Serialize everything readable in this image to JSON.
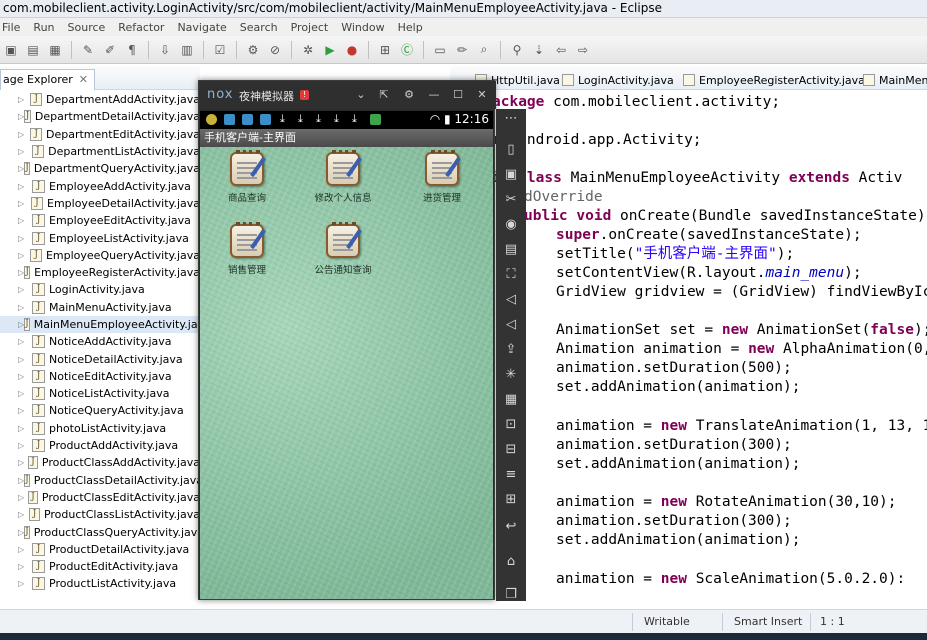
{
  "window": {
    "title": "com.mobileclient.activity.LoginActivity/src/com/mobileclient/activity/MainMenuEmployeeActivity.java - Eclipse"
  },
  "menu": [
    "File",
    "Run",
    "Source",
    "Refactor",
    "Navigate",
    "Search",
    "Project",
    "Window",
    "Help"
  ],
  "package_explorer": {
    "tab_label": "age Explorer",
    "close_glyph": "✕",
    "files": [
      "DepartmentAddActivity.java",
      "DepartmentDetailActivity.java",
      "DepartmentEditActivity.java",
      "DepartmentListActivity.java",
      "DepartmentQueryActivity.java",
      "EmployeeAddActivity.java",
      "EmployeeDetailActivity.java",
      "EmployeeEditActivity.java",
      "EmployeeListActivity.java",
      "EmployeeQueryActivity.java",
      "EmployeeRegisterActivity.java",
      "LoginActivity.java",
      "MainMenuActivity.java",
      "MainMenuEmployeeActivity.java",
      "NoticeAddActivity.java",
      "NoticeDetailActivity.java",
      "NoticeEditActivity.java",
      "NoticeListActivity.java",
      "NoticeQueryActivity.java",
      "photoListActivity.java",
      "ProductAddActivity.java",
      "ProductClassAddActivity.java",
      "ProductClassDetailActivity.java",
      "ProductClassEditActivity.java",
      "ProductClassListActivity.java",
      "ProductClassQueryActivity.java",
      "ProductDetailActivity.java",
      "ProductEditActivity.java",
      "ProductListActivity.java"
    ],
    "selected_index": 13
  },
  "editor": {
    "tabs": [
      "HttpUtil.java",
      "LoginActivity.java",
      "EmployeeRegisterActivity.java",
      "MainMenu"
    ],
    "code": {
      "l1_kw": "ackage",
      "l1_rest": " com.mobileclient.activity;",
      "l2_kw": "rt",
      "l2_rest": " android.app.Activity;",
      "l3_kw1": "ic",
      "l3_kw2": "class",
      "l3_mid": " MainMenuEmployeeActivity ",
      "l3_kw3": "extends",
      "l3_rest": " Activ",
      "l4": "dOverride",
      "l5_kw1": "ublic",
      "l5_kw2": "void",
      "l5_rest": " onCreate(Bundle savedInstanceState)",
      "l6_kw": "super",
      "l6_rest": ".onCreate(savedInstanceState);",
      "l7_a": "setTitle(",
      "l7_str": "\"手机客户端-主界面\"",
      "l7_b": ");",
      "l8_a": "setContentView(R.layout.",
      "l8_it": "main_menu",
      "l8_b": ");",
      "l9": "GridView gridview = (GridView) findViewByIc",
      "l10_a": "AnimationSet set = ",
      "l10_kw": "new",
      "l10_b": " AnimationSet(",
      "l10_kw2": "false",
      "l10_c": ");",
      "l11_a": "Animation animation = ",
      "l11_kw": "new",
      "l11_b": " AlphaAnimation(0,",
      "l12": "animation.setDuration(500);",
      "l13": "set.addAnimation(animation);",
      "l14_a": "animation = ",
      "l14_kw": "new",
      "l14_b": " TranslateAnimation(1, 13, 1",
      "l15": "animation.setDuration(300);",
      "l16": "set.addAnimation(animation);",
      "l17_a": "animation = ",
      "l17_kw": "new",
      "l17_b": " RotateAnimation(30,10);",
      "l18": "animation.setDuration(300);",
      "l19": "set.addAnimation(animation);",
      "l20_a": "animation = ",
      "l20_kw": "new",
      "l20_b": " ScaleAnimation(5.0.2.0):"
    }
  },
  "status": {
    "writable": "Writable",
    "insert_mode": "Smart Insert",
    "position": "1 : 1"
  },
  "emulator": {
    "logo": "nox",
    "title": "夜神模拟器",
    "badge": "!",
    "clock": "12:16",
    "app_title": "手机客户端-主界面",
    "grid": [
      {
        "label": "商品查询"
      },
      {
        "label": "修改个人信息"
      },
      {
        "label": "进货管理"
      },
      {
        "label": "销售管理"
      },
      {
        "label": "公告通知查询"
      }
    ]
  },
  "colors": {
    "keyword": "#7f0055",
    "string": "#2a00ff",
    "selection": "#dde8f7",
    "emulator_bg": "#8fc7a9"
  }
}
